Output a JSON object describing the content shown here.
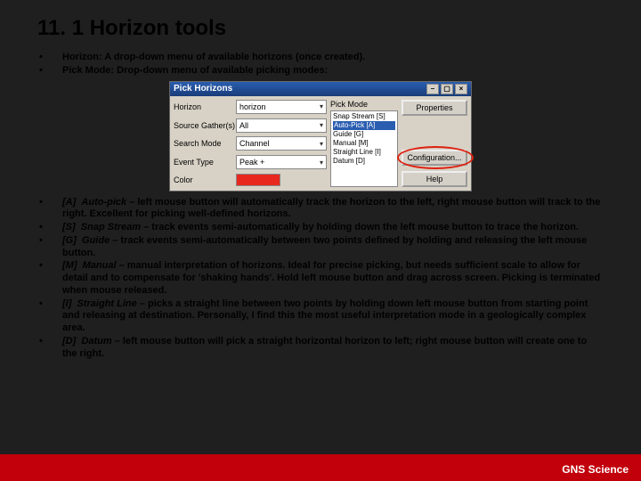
{
  "title": "11. 1 Horizon tools",
  "top_bullets": [
    "Horizon: A drop-down menu of available horizons (once created).",
    "Pick Mode: Drop-down menu of available picking modes:"
  ],
  "dialog": {
    "title": "Pick Horizons",
    "labels": {
      "horizon": "Horizon",
      "source": "Source Gather(s)",
      "search": "Search Mode",
      "event": "Event Type",
      "color": "Color"
    },
    "fields": {
      "horizon": "horizon",
      "source": "All",
      "search": "Channel",
      "event": "Peak +"
    },
    "pickmode_label": "Pick Mode",
    "pick_options": [
      "Snap Stream [S]",
      "Auto-Pick [A]",
      "Guide [G]",
      "Manual [M]",
      "Straight Line [I]",
      "Datum [D]"
    ],
    "pick_selected": "Auto-Pick [A]",
    "buttons": {
      "properties": "Properties",
      "config": "Configuration...",
      "help": "Help"
    }
  },
  "modes": [
    {
      "tag": "[A]",
      "name": "Auto-pick",
      "desc": " – left mouse button will automatically track the horizon to the left, right mouse button will track to the right. Excellent for picking well-defined horizons."
    },
    {
      "tag": "[S]",
      "name": "Snap Stream",
      "desc": " – track events semi-automatically by holding down the left mouse button to trace the horizon."
    },
    {
      "tag": "[G]",
      "name": "Guide",
      "desc": " – track events semi-automatically between two points defined by holding and releasing the left mouse button."
    },
    {
      "tag": "[M]",
      "name": "Manual",
      "desc": " – manual interpretation of horizons. Ideal for precise picking, but needs sufficient scale to allow for detail and to compensate for 'shaking hands'. Hold left mouse button and drag across screen. Picking is terminated when mouse released."
    },
    {
      "tag": "[I]",
      "name": "Straight Line",
      "desc": " – picks a straight line between two points by holding down left mouse button from starting point and releasing at destination. Personally, I find this the most useful interpretation mode in a geologically complex area."
    },
    {
      "tag": "[D]",
      "name": "Datum",
      "desc": " – left mouse button will pick a straight horizontal horizon to left; right mouse button will create one to the right."
    }
  ],
  "footer": "GNS Science"
}
